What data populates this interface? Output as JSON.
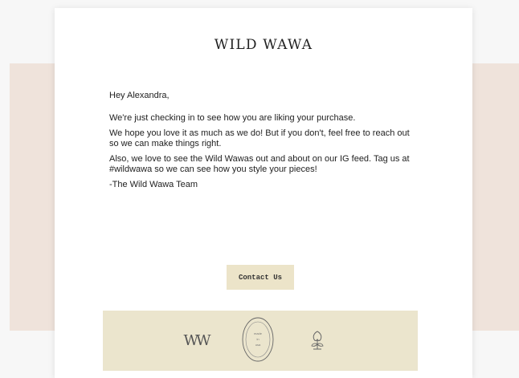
{
  "email": {
    "brand": "WILD WAWA",
    "greeting": "Hey Alexandra,",
    "paragraphs": [
      "We're just checking in to see how you are liking your purchase.",
      "We hope you love it as much as we do! But if you don't, feel free to reach out so we can make things right.",
      "Also, we love to see the Wild Wawas out and about on our IG feed. Tag us at #wildwawa so we can see how you style your pieces!"
    ],
    "signoff": "-The Wild Wawa Team",
    "cta_label": "Contact Us"
  },
  "footer": {
    "monogram": "W",
    "seal_lines": [
      "made",
      "in",
      "usa"
    ]
  },
  "colors": {
    "page_bg": "#f7f7f7",
    "band": "#efe3db",
    "button": "#ece4c9",
    "footer": "#ebe5cd",
    "text": "#222222"
  }
}
